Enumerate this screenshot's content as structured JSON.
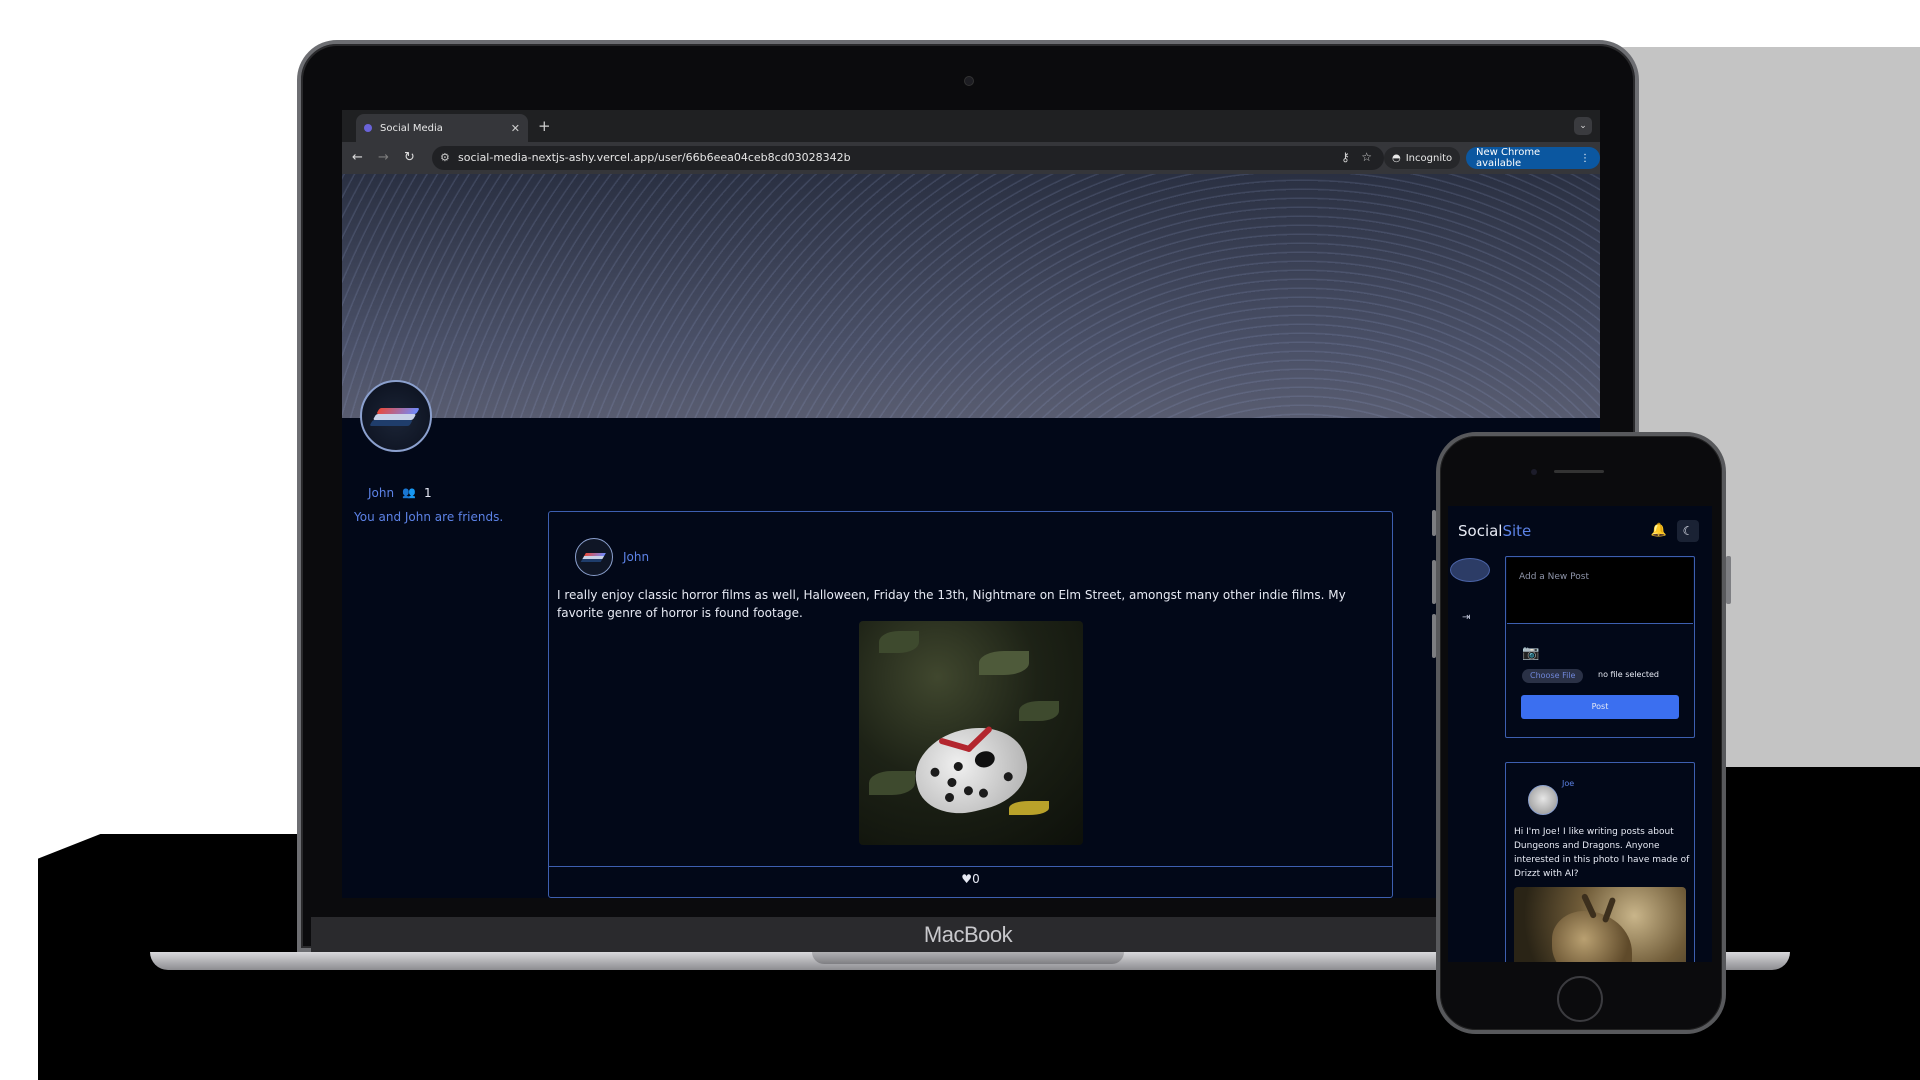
{
  "browser": {
    "tab_title": "Social Media",
    "url": "social-media-nextjs-ashy.vercel.app/user/66b6eea04ceb8cd03028342b",
    "incognito_label": "Incognito",
    "update_label": "New Chrome available"
  },
  "profile": {
    "name": "John",
    "friends_count": "1",
    "friend_status": "You and John are friends."
  },
  "post": {
    "author": "John",
    "text": "I really enjoy classic horror films as well, Halloween, Friday the 13th, Nightmare on Elm Street, amongst many other indie films. My favorite genre of horror is found footage.",
    "likes": "0"
  },
  "laptop": {
    "brand": "MacBook"
  },
  "phone": {
    "logo_part1": "Social",
    "logo_part2": "Site",
    "composer_placeholder": "Add a New Post",
    "choose_file_label": "Choose File",
    "no_file_label": "no file selected",
    "post_button_label": "Post",
    "feed_author": "Joe",
    "feed_text": "Hi I'm Joe! I like writing posts about Dungeons and Dragons. Anyone interested in this photo I have made of Drizzt with AI?"
  },
  "icons": {
    "back": "arrow-left-icon",
    "forward": "arrow-right-icon",
    "reload": "reload-icon",
    "friends": "people-icon",
    "like": "heart-icon",
    "notifications": "bell-icon",
    "theme": "moon-icon",
    "camera": "camera-icon"
  },
  "colors": {
    "accent": "#5c82e6",
    "page_bg": "#020818",
    "border": "#3d5fb0",
    "post_button": "#3b6ff0",
    "chrome_update": "#0b57a0"
  }
}
